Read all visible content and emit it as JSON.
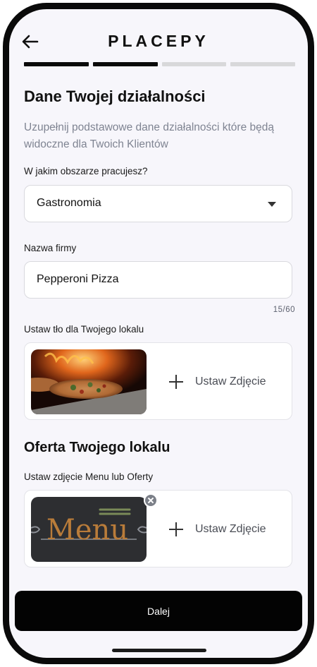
{
  "header": {
    "title": "PLACEPY"
  },
  "progress": {
    "total_steps": 4,
    "current_step": 2
  },
  "business": {
    "title": "Dane Twojej działalności",
    "subtitle": "Uzupełnij podstawowe dane działalności które będą widoczne dla Twoich Klientów",
    "area_label": "W jakim obszarze pracujesz?",
    "area_value": "Gastronomia",
    "company_label": "Nazwa firmy",
    "company_value": "Pepperoni Pizza",
    "company_counter": "15/60",
    "background_label": "Ustaw tło dla Twojego lokalu",
    "background_add": "Ustaw Zdjęcie"
  },
  "offer": {
    "title": "Oferta Twojego lokalu",
    "menu_label": "Ustaw zdjęcie Menu lub Oferty",
    "menu_add": "Ustaw Zdjęcie",
    "menu_image_text": "Menu"
  },
  "footer": {
    "next_label": "Dalej"
  },
  "colors": {
    "primary": "#030303",
    "muted": "#7f8492",
    "screen_bg": "#f7f6fb"
  }
}
